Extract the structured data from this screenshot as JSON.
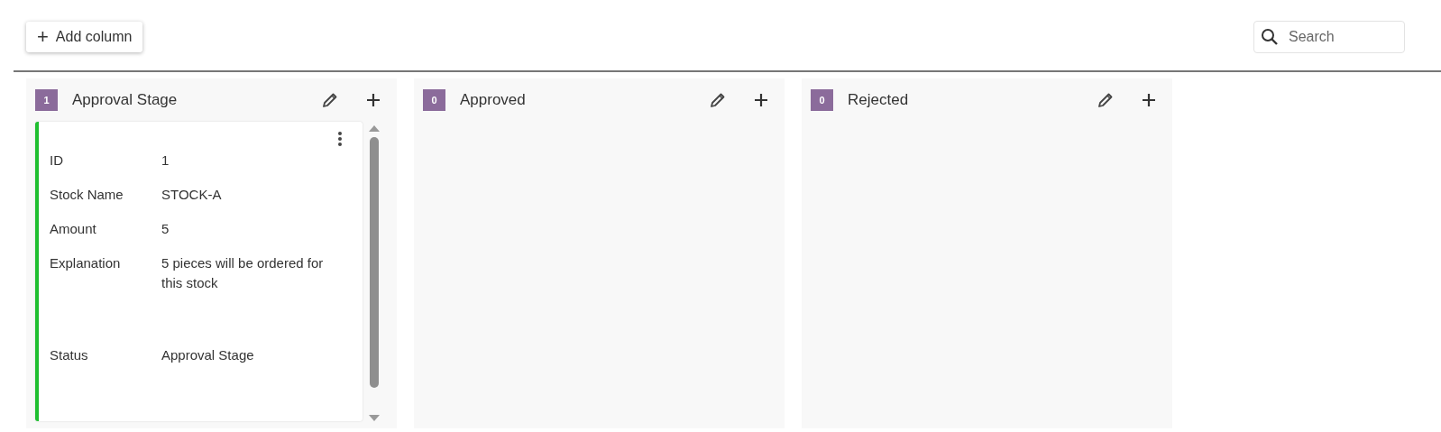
{
  "toolbar": {
    "add_button": {
      "icon": "+",
      "label": "Add column"
    },
    "search": {
      "placeholder": "Search"
    }
  },
  "columns": [
    {
      "count": "1",
      "title": "Approval Stage",
      "cards": [
        {
          "color": "#1fbf30",
          "fields": [
            {
              "label": "ID",
              "value": "1"
            },
            {
              "label": "Stock Name",
              "value": "STOCK-A"
            },
            {
              "label": "Amount",
              "value": "5"
            },
            {
              "label": "Explanation",
              "value": "5 pieces will be ordered for this stock"
            },
            {
              "label": "Status",
              "value": "Approval Stage"
            }
          ]
        }
      ]
    },
    {
      "count": "0",
      "title": "Approved"
    },
    {
      "count": "0",
      "title": "Rejected"
    }
  ]
}
